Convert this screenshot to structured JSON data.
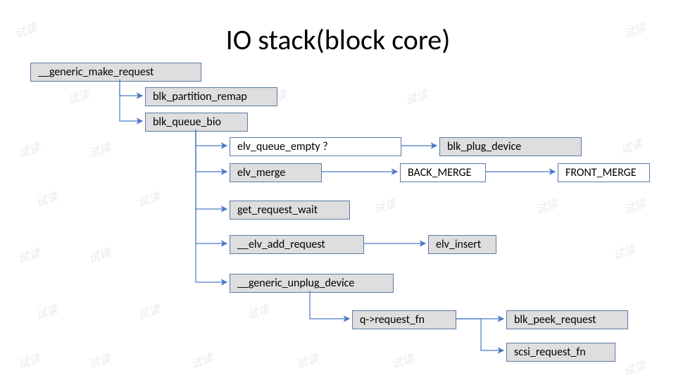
{
  "title": "IO stack(block core)",
  "nodes": {
    "generic_make_request": "__generic_make_request",
    "blk_partition_remap": "blk_partition_remap",
    "blk_queue_bio": "blk_queue_bio",
    "elv_queue_empty": "elv_queue_empty ?",
    "blk_plug_device": "blk_plug_device",
    "elv_merge": "elv_merge",
    "back_merge": "BACK_MERGE",
    "front_merge": "FRONT_MERGE",
    "get_request_wait": "get_request_wait",
    "elv_add_request": "__elv_add_request",
    "elv_insert": "elv_insert",
    "generic_unplug_device": "__generic_unplug_device",
    "q_request_fn": "q->request_fn",
    "blk_peek_request": "blk_peek_request",
    "scsi_request_fn": "scsi_request_fn"
  },
  "watermark_text": "试读",
  "colors": {
    "node_border": "#5b7aa7",
    "arrow": "#4a7ac7",
    "fill": "#dedede"
  }
}
